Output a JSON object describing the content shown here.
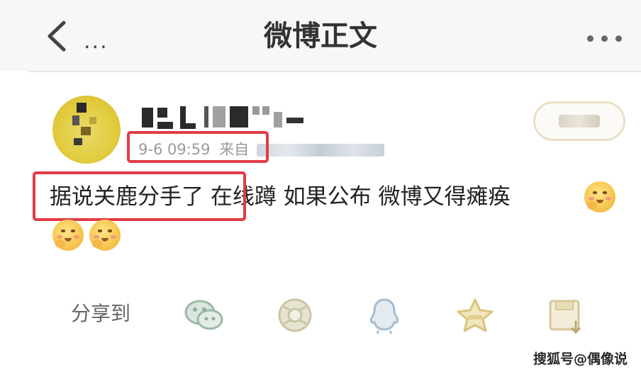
{
  "nav": {
    "more_left": "...",
    "title": "微博正文"
  },
  "post": {
    "meta_time": "9-6 09:59",
    "meta_from": "来自",
    "text": "据说关鹿分手了 在线蹲 如果公布 微博又得瘫痪"
  },
  "share": {
    "label": "分享到",
    "icons": [
      "wechat-icon",
      "moments-icon",
      "qq-icon",
      "qzone-icon",
      "save-icon"
    ]
  },
  "watermark": "搜狐号@偶像说",
  "colors": {
    "highlight_box": "#e23b46",
    "nav_bg": "#f7f7f7",
    "meta_text": "#9a9a9a",
    "avatar_yellow": "#e2cc3e"
  }
}
